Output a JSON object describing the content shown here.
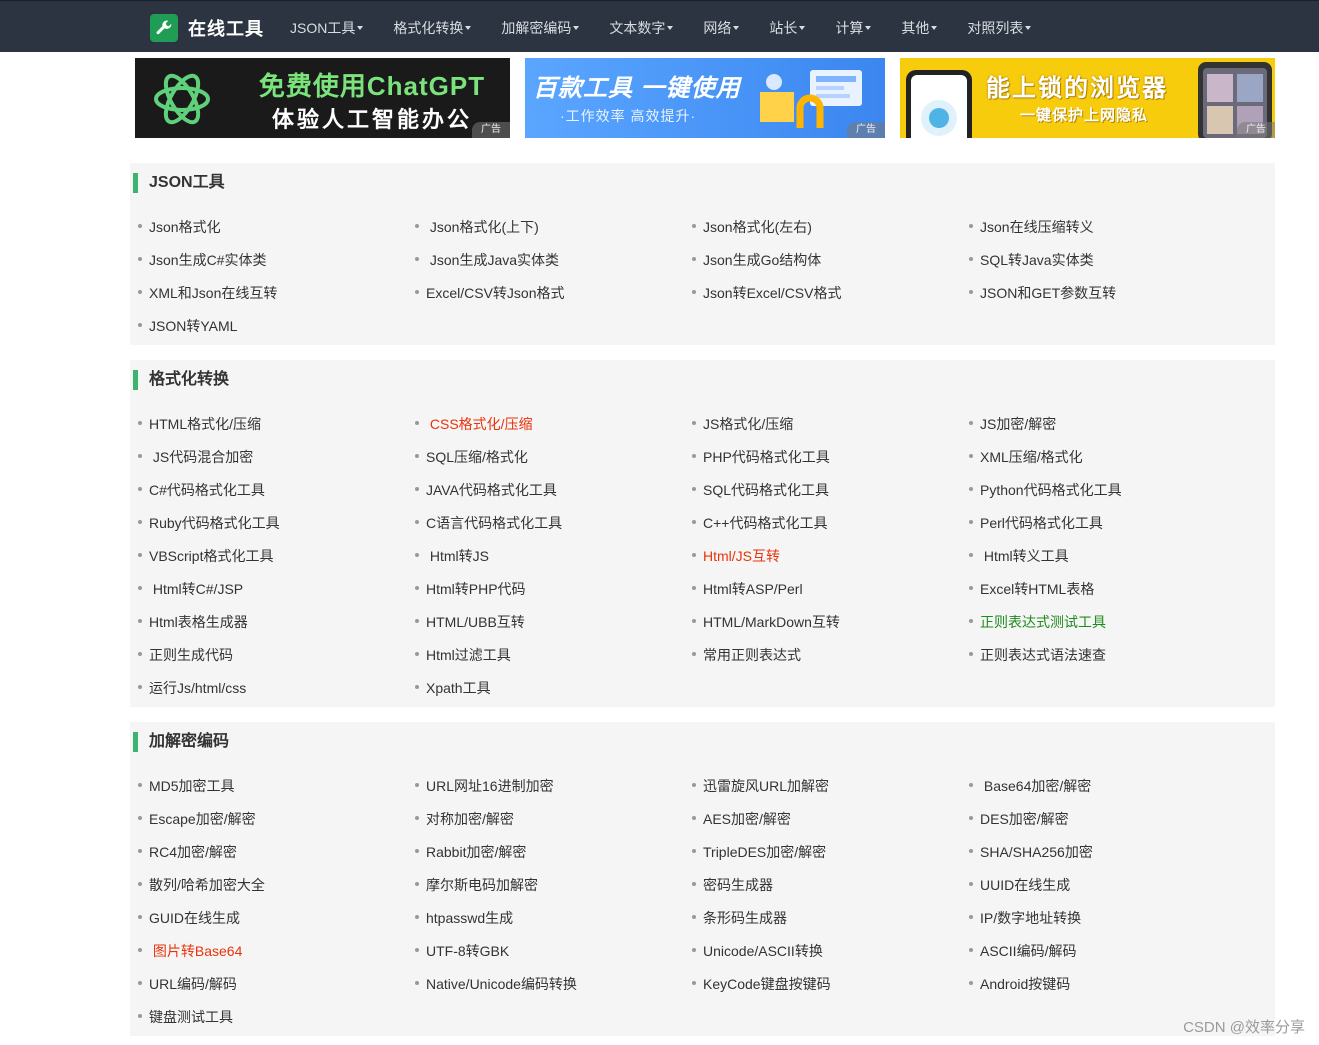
{
  "brand": {
    "title": "在线工具"
  },
  "nav": [
    "JSON工具",
    "格式化转换",
    "加解密编码",
    "文本数字",
    "网络",
    "站长",
    "计算",
    "其他",
    "对照列表"
  ],
  "ads": [
    {
      "line1": "免费使用ChatGPT",
      "line2": "体验人工智能办公",
      "tag": "广告"
    },
    {
      "line1": "百款工具 一键使用",
      "line2": "·工作效率 高效提升·",
      "tag": "广告"
    },
    {
      "line1": "能上锁的浏览器",
      "line2": "一键保护上网隐私",
      "tag": "广告"
    }
  ],
  "colors": {
    "nav_bg": "#2b3440",
    "section_bar": "#3cb371",
    "red": "#e8340c",
    "green": "#1f8a1f"
  },
  "sections": [
    {
      "title": "JSON工具",
      "links": [
        {
          "t": "Json格式化"
        },
        {
          "t": " Json格式化(上下)"
        },
        {
          "t": "Json格式化(左右)"
        },
        {
          "t": "Json在线压缩转义"
        },
        {
          "t": "Json生成C#实体类"
        },
        {
          "t": " Json生成Java实体类"
        },
        {
          "t": "Json生成Go结构体"
        },
        {
          "t": "SQL转Java实体类"
        },
        {
          "t": "XML和Json在线互转"
        },
        {
          "t": "Excel/CSV转Json格式"
        },
        {
          "t": "Json转Excel/CSV格式"
        },
        {
          "t": "JSON和GET参数互转"
        },
        {
          "t": "JSON转YAML"
        }
      ]
    },
    {
      "title": "格式化转换",
      "links": [
        {
          "t": "HTML格式化/压缩"
        },
        {
          "t": " CSS格式化/压缩",
          "c": "red"
        },
        {
          "t": "JS格式化/压缩"
        },
        {
          "t": "JS加密/解密"
        },
        {
          "t": " JS代码混合加密"
        },
        {
          "t": "SQL压缩/格式化"
        },
        {
          "t": "PHP代码格式化工具"
        },
        {
          "t": "XML压缩/格式化"
        },
        {
          "t": "C#代码格式化工具"
        },
        {
          "t": "JAVA代码格式化工具"
        },
        {
          "t": "SQL代码格式化工具"
        },
        {
          "t": "Python代码格式化工具"
        },
        {
          "t": "Ruby代码格式化工具"
        },
        {
          "t": "C语言代码格式化工具"
        },
        {
          "t": "C++代码格式化工具"
        },
        {
          "t": "Perl代码格式化工具"
        },
        {
          "t": "VBScript格式化工具"
        },
        {
          "t": " Html转JS"
        },
        {
          "t": "Html/JS互转",
          "c": "red"
        },
        {
          "t": " Html转义工具"
        },
        {
          "t": " Html转C#/JSP"
        },
        {
          "t": "Html转PHP代码"
        },
        {
          "t": "Html转ASP/Perl"
        },
        {
          "t": "Excel转HTML表格"
        },
        {
          "t": "Html表格生成器"
        },
        {
          "t": "HTML/UBB互转"
        },
        {
          "t": "HTML/MarkDown互转"
        },
        {
          "t": "正则表达式测试工具",
          "c": "green"
        },
        {
          "t": "正则生成代码"
        },
        {
          "t": "Html过滤工具"
        },
        {
          "t": "常用正则表达式"
        },
        {
          "t": "正则表达式语法速查"
        },
        {
          "t": "运行Js/html/css"
        },
        {
          "t": "Xpath工具"
        }
      ]
    },
    {
      "title": "加解密编码",
      "links": [
        {
          "t": "MD5加密工具"
        },
        {
          "t": "URL网址16进制加密"
        },
        {
          "t": "迅雷旋风URL加解密"
        },
        {
          "t": " Base64加密/解密"
        },
        {
          "t": "Escape加密/解密"
        },
        {
          "t": "对称加密/解密"
        },
        {
          "t": "AES加密/解密"
        },
        {
          "t": "DES加密/解密"
        },
        {
          "t": "RC4加密/解密"
        },
        {
          "t": "Rabbit加密/解密"
        },
        {
          "t": "TripleDES加密/解密"
        },
        {
          "t": "SHA/SHA256加密"
        },
        {
          "t": "散列/哈希加密大全"
        },
        {
          "t": "摩尔斯电码加解密"
        },
        {
          "t": "密码生成器"
        },
        {
          "t": "UUID在线生成"
        },
        {
          "t": "GUID在线生成"
        },
        {
          "t": "htpasswd生成"
        },
        {
          "t": "条形码生成器"
        },
        {
          "t": "IP/数字地址转换"
        },
        {
          "t": " 图片转Base64",
          "c": "red"
        },
        {
          "t": "UTF-8转GBK"
        },
        {
          "t": "Unicode/ASCII转换"
        },
        {
          "t": "ASCII编码/解码"
        },
        {
          "t": "URL编码/解码"
        },
        {
          "t": "Native/Unicode编码转换"
        },
        {
          "t": "KeyCode键盘按键码"
        },
        {
          "t": "Android按键码"
        },
        {
          "t": "键盘测试工具"
        }
      ]
    }
  ],
  "watermark": "CSDN @效率分享"
}
